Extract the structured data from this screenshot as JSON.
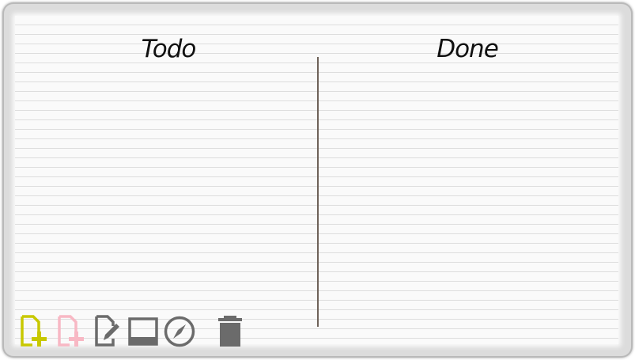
{
  "columns": {
    "todo_title": "Todo",
    "done_title": "Done"
  },
  "toolbar": {
    "tools": [
      {
        "name": "add-note-yellow",
        "icon": "add-note-icon",
        "color": "#c8c800"
      },
      {
        "name": "add-note-pink",
        "icon": "add-note-icon",
        "color": "#f8b8c4"
      },
      {
        "name": "edit-note",
        "icon": "edit-note-icon",
        "color": "#6b6b6b"
      },
      {
        "name": "display",
        "icon": "monitor-icon",
        "color": "#6b6b6b"
      },
      {
        "name": "compass",
        "icon": "compass-icon",
        "color": "#6b6b6b"
      },
      {
        "name": "delete",
        "icon": "trash-icon",
        "color": "#6b6b6b"
      }
    ]
  },
  "colors": {
    "paper": "#fafafa",
    "rule_line": "#dddddd",
    "divider": "#6e6259",
    "frame": "#dcdcdc"
  }
}
